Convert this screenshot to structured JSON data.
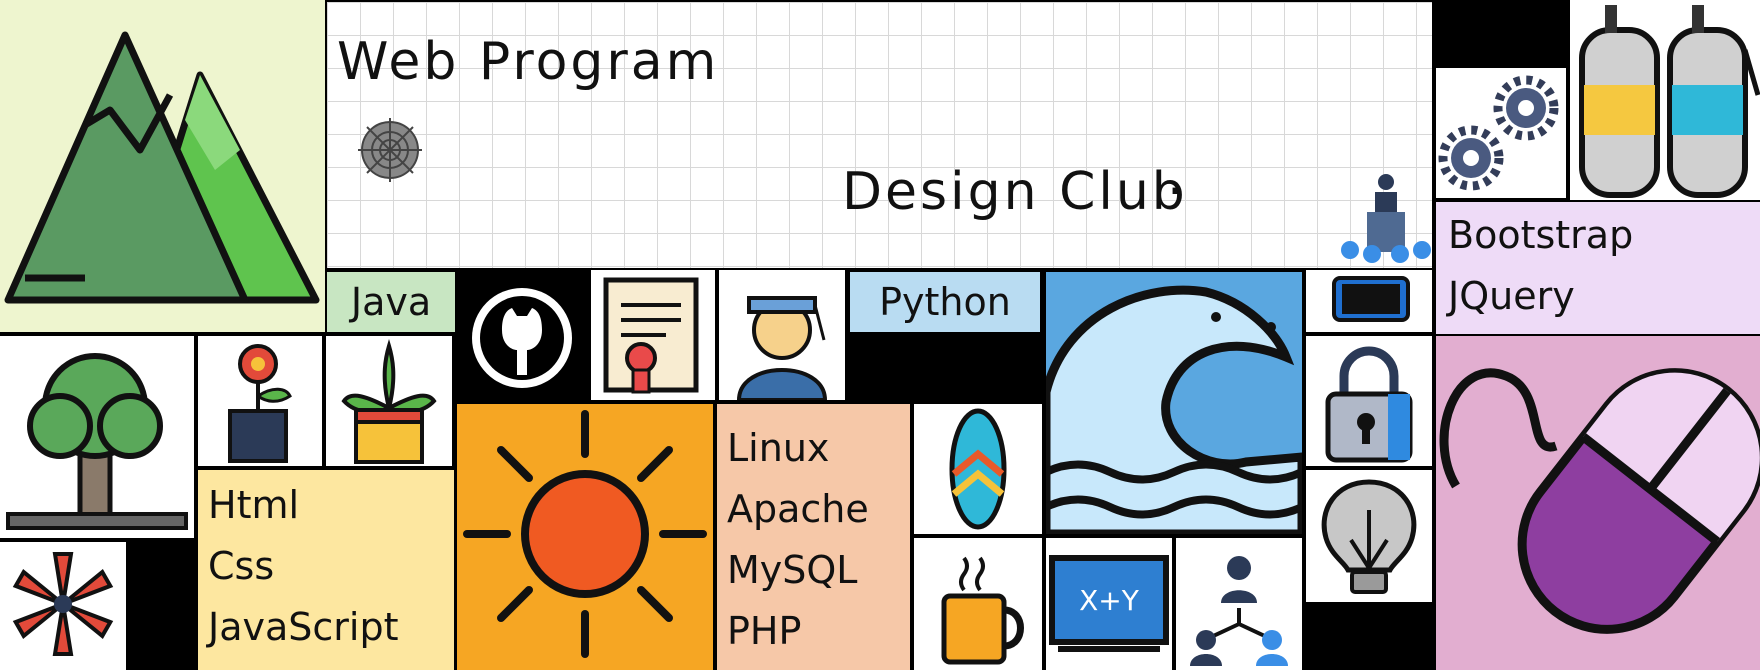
{
  "banner": {
    "title_line1": "Web Program",
    "title_line2": "Design Club",
    "title_suffix": "·"
  },
  "tags": {
    "java": "Java",
    "python": "Python",
    "frontend": [
      "Html",
      "Css",
      "JavaScript"
    ],
    "lamp": [
      "Linux",
      "Apache",
      "MySQL",
      "PHP"
    ],
    "libs": [
      "Bootstrap",
      "JQuery"
    ]
  },
  "formula_board": "X+Y",
  "colors": {
    "mountain_bg": "#eef5cf",
    "java_bg": "#c8e6c2",
    "python_bg": "#b9dcf2",
    "frontend_bg": "#fde7a0",
    "lamp_bg": "#f6c8a8",
    "sun_bg": "#f6a623",
    "libs_bg": "#eedbf7",
    "mouse_bg": "#e2aed0",
    "wave_bg": "#5aa7e0"
  }
}
